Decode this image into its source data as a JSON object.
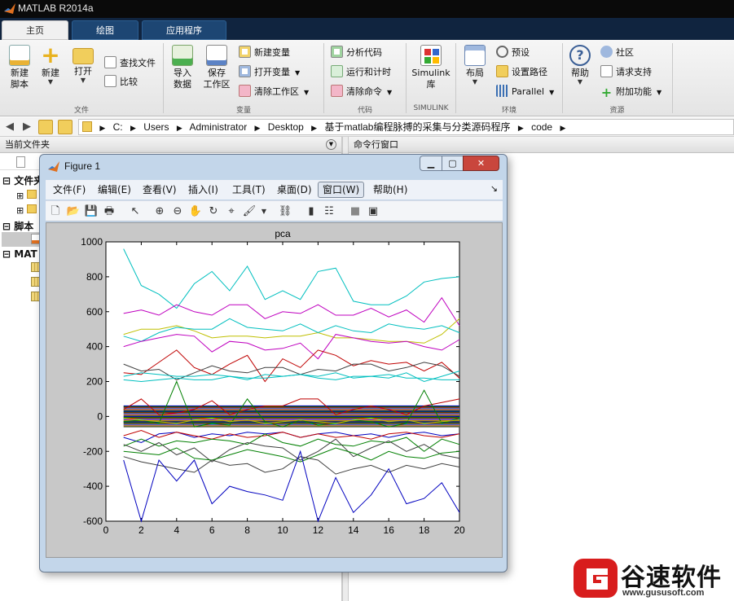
{
  "titlebar": {
    "title": "MATLAB R2014a"
  },
  "tabs": [
    {
      "label": "主页",
      "active": true
    },
    {
      "label": "绘图",
      "active": false
    },
    {
      "label": "应用程序",
      "active": false
    }
  ],
  "ribbon": {
    "file": {
      "new_script": "新建\n脚本",
      "new": "新建",
      "open": "打开",
      "find_files": "查找文件",
      "compare": "比较",
      "group": "文件"
    },
    "variable": {
      "import": "导入\n数据",
      "save_ws": "保存\n工作区",
      "new_var": "新建变量",
      "open_var": "打开变量",
      "clear_ws": "清除工作区",
      "group": "变量"
    },
    "code": {
      "analyze": "分析代码",
      "run_time": "运行和计时",
      "clear_cmd": "清除命令",
      "group": "代码"
    },
    "simulink": {
      "lib": "Simulink\n库",
      "group": "SIMULINK"
    },
    "env": {
      "layout": "布局",
      "prefs": "预设",
      "set_path": "设置路径",
      "parallel": "Parallel",
      "group": "环境"
    },
    "resources": {
      "help": "帮助",
      "community": "社区",
      "support": "请求支持",
      "addons": "附加功能",
      "group": "资源"
    }
  },
  "address": {
    "crumbs": [
      "C:",
      "Users",
      "Administrator",
      "Desktop",
      "基于matlab编程脉搏的采集与分类源码程序",
      "code"
    ]
  },
  "left_panel": {
    "header": "当前文件夹",
    "sections": [
      {
        "label": "文件夹"
      },
      {
        "label": "脚本"
      },
      {
        "label": "MAT"
      }
    ]
  },
  "right_panel": {
    "header": "命令行窗口"
  },
  "figure": {
    "title": "Figure 1",
    "menus": [
      {
        "label": "文件(F)"
      },
      {
        "label": "编辑(E)"
      },
      {
        "label": "查看(V)"
      },
      {
        "label": "插入(I)"
      },
      {
        "label": "工具(T)"
      },
      {
        "label": "桌面(D)"
      },
      {
        "label": "窗口(W)",
        "active": true
      },
      {
        "label": "帮助(H)"
      }
    ]
  },
  "chart_data": {
    "type": "line",
    "title": "pca",
    "xlabel": "",
    "ylabel": "",
    "xlim": [
      0,
      20
    ],
    "ylim": [
      -600,
      1000
    ],
    "xticks": [
      0,
      2,
      4,
      6,
      8,
      10,
      12,
      14,
      16,
      18,
      20
    ],
    "yticks": [
      -600,
      -400,
      -200,
      0,
      200,
      400,
      600,
      800,
      1000
    ],
    "grid": false,
    "legend": "none",
    "x": [
      1,
      2,
      3,
      4,
      5,
      6,
      7,
      8,
      9,
      10,
      11,
      12,
      13,
      14,
      15,
      16,
      17,
      18,
      19,
      20
    ],
    "series": [
      {
        "color": "#00bfbf",
        "values": [
          960,
          750,
          700,
          620,
          760,
          830,
          720,
          860,
          670,
          720,
          670,
          830,
          850,
          660,
          640,
          640,
          690,
          770,
          790,
          800
        ]
      },
      {
        "color": "#bf00bf",
        "values": [
          590,
          610,
          580,
          640,
          600,
          580,
          640,
          640,
          560,
          600,
          590,
          640,
          580,
          580,
          620,
          570,
          610,
          540,
          680,
          520
        ]
      },
      {
        "color": "#bfbf00",
        "values": [
          470,
          500,
          500,
          520,
          490,
          450,
          460,
          460,
          450,
          460,
          460,
          480,
          450,
          450,
          440,
          430,
          430,
          420,
          470,
          560
        ]
      },
      {
        "color": "#00bfbf",
        "values": [
          460,
          430,
          480,
          510,
          500,
          500,
          560,
          510,
          500,
          490,
          530,
          480,
          520,
          490,
          480,
          530,
          510,
          500,
          520,
          480
        ]
      },
      {
        "color": "#bf00bf",
        "values": [
          400,
          430,
          450,
          470,
          460,
          370,
          430,
          420,
          380,
          390,
          420,
          330,
          470,
          450,
          430,
          420,
          430,
          400,
          380,
          440
        ]
      },
      {
        "color": "#bf0000",
        "values": [
          250,
          240,
          310,
          380,
          280,
          240,
          300,
          350,
          200,
          330,
          280,
          380,
          350,
          290,
          320,
          300,
          310,
          260,
          310,
          220
        ]
      },
      {
        "color": "#404040",
        "values": [
          300,
          260,
          270,
          210,
          250,
          290,
          260,
          250,
          280,
          280,
          240,
          270,
          260,
          300,
          300,
          260,
          280,
          310,
          290,
          230
        ]
      },
      {
        "color": "#00bfbf",
        "values": [
          230,
          250,
          240,
          230,
          230,
          240,
          230,
          210,
          240,
          230,
          240,
          230,
          250,
          220,
          230,
          220,
          250,
          200,
          230,
          260
        ]
      },
      {
        "color": "#00bfbf",
        "values": [
          210,
          200,
          210,
          220,
          210,
          210,
          230,
          220,
          220,
          230,
          240,
          220,
          210,
          230,
          230,
          240,
          220,
          220,
          210,
          210
        ]
      },
      {
        "color": "#bf0000",
        "values": [
          40,
          100,
          10,
          20,
          40,
          90,
          10,
          40,
          60,
          60,
          100,
          100,
          10,
          40,
          60,
          40,
          10,
          60,
          80,
          100
        ]
      },
      {
        "color": "#007f00",
        "values": [
          -30,
          -20,
          -40,
          200,
          -60,
          -40,
          -50,
          100,
          -30,
          -60,
          -20,
          -50,
          -40,
          -20,
          -30,
          -60,
          -40,
          150,
          -40,
          -10
        ]
      },
      {
        "color": "#bfbf00",
        "values": [
          -10,
          -20,
          -30,
          -40,
          -20,
          -10,
          -30,
          -20,
          -40,
          -30,
          -20,
          -30,
          -40,
          -20,
          -10,
          -30,
          -20,
          -40,
          -30,
          -20
        ]
      },
      {
        "color": "#0000bf",
        "values": [
          -120,
          -150,
          -100,
          -90,
          -120,
          -100,
          -110,
          -90,
          -100,
          -90,
          -120,
          -100,
          -90,
          -110,
          -100,
          -120,
          -100,
          -90,
          -110,
          -100
        ]
      },
      {
        "color": "#bf0000",
        "values": [
          -110,
          -80,
          -120,
          -90,
          -110,
          -130,
          -100,
          -120,
          -110,
          -90,
          -120,
          -100,
          -120,
          -110,
          -130,
          -100,
          -90,
          -110,
          -120,
          -100
        ]
      },
      {
        "color": "#007f00",
        "values": [
          -170,
          -130,
          -170,
          -140,
          -150,
          -130,
          -140,
          -160,
          -100,
          -150,
          -170,
          -130,
          -160,
          -170,
          -140,
          -150,
          -120,
          -200,
          -130,
          -160
        ]
      },
      {
        "color": "#404040",
        "values": [
          -160,
          -200,
          -150,
          -220,
          -180,
          -260,
          -190,
          -150,
          -170,
          -180,
          -250,
          -200,
          -130,
          -230,
          -180,
          -140,
          -200,
          -160,
          -220,
          -240
        ]
      },
      {
        "color": "#007f00",
        "values": [
          -200,
          -210,
          -220,
          -180,
          -240,
          -250,
          -220,
          -190,
          -210,
          -230,
          -260,
          -220,
          -180,
          -210,
          -250,
          -200,
          -230,
          -240,
          -210,
          -200
        ]
      },
      {
        "color": "#404040",
        "values": [
          -230,
          -260,
          -280,
          -300,
          -320,
          -250,
          -280,
          -270,
          -320,
          -300,
          -230,
          -250,
          -330,
          -300,
          -280,
          -320,
          -280,
          -300,
          -270,
          -290
        ]
      },
      {
        "color": "#0000bf",
        "values": [
          -250,
          -600,
          -250,
          -370,
          -250,
          -500,
          -400,
          -430,
          -450,
          -480,
          -200,
          -600,
          -350,
          -550,
          -450,
          -300,
          -500,
          -470,
          -380,
          -550
        ]
      }
    ]
  },
  "watermark": {
    "brand": "谷速软件",
    "url": "www.gususoft.com",
    "color": "#d81d1d"
  }
}
